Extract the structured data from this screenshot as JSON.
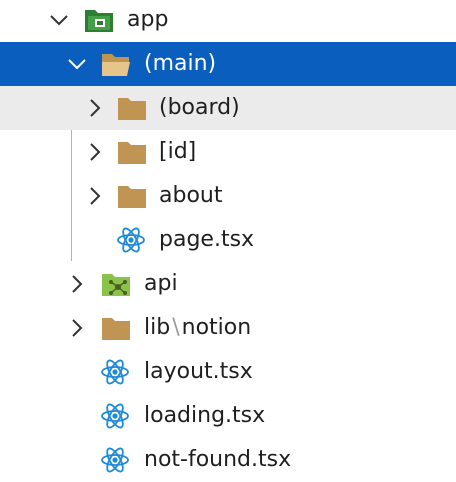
{
  "explorer": {
    "items": [
      {
        "label": "app",
        "kind": "folder-app",
        "expanded": true,
        "depth": 0
      },
      {
        "label": "(main)",
        "kind": "folder-open",
        "expanded": true,
        "depth": 1,
        "selected": true
      },
      {
        "label": "(board)",
        "kind": "folder",
        "expanded": false,
        "depth": 2,
        "hovered": true
      },
      {
        "label": "[id]",
        "kind": "folder",
        "expanded": false,
        "depth": 2
      },
      {
        "label": "about",
        "kind": "folder",
        "expanded": false,
        "depth": 2
      },
      {
        "label": "page.tsx",
        "kind": "react-file",
        "depth": 2
      },
      {
        "label": "api",
        "kind": "folder-api",
        "expanded": false,
        "depth": 1
      },
      {
        "label_part1": "lib",
        "separator": "\\",
        "label_part2": "notion",
        "kind": "folder",
        "expanded": false,
        "depth": 1
      },
      {
        "label": "layout.tsx",
        "kind": "react-file",
        "depth": 1
      },
      {
        "label": "loading.tsx",
        "kind": "react-file",
        "depth": 1
      },
      {
        "label": "not-found.tsx",
        "kind": "react-file",
        "depth": 1
      }
    ]
  },
  "colors": {
    "selection": "#0a5ebd",
    "hover": "#ebebeb",
    "folder": "#c09553",
    "app_folder": "#2e7d32",
    "api_folder": "#8bc34a",
    "react": "#1e8ad6"
  }
}
